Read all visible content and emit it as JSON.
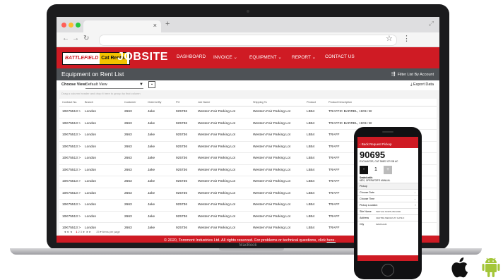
{
  "laptop": {
    "brand": "MacBook"
  },
  "browser": {
    "traffic_lights": [
      "#ff5f57",
      "#febc2e",
      "#28c840"
    ],
    "tab_close": "×",
    "new_tab": "+",
    "expand": "⤢",
    "back": "←",
    "forward": "→",
    "reload": "↻",
    "star": "☆",
    "menu": "⋮"
  },
  "header": {
    "logo_battlefield": "BATTLEFIELD",
    "logo_cat": "Cat Rental",
    "logo_jobsite": "JOBSITE",
    "nav": [
      "DASHBOARD",
      "INVOICE ⌄",
      "EQUIPMENT ⌄",
      "REPORT ⌄",
      "CONTACT US"
    ],
    "brand_color": "#cf1b24"
  },
  "page": {
    "title": "Equipment on Rent List",
    "filter_label": "Filter List By Account",
    "choose_view_label": "Choose View:",
    "view_value": "Default View",
    "export_label": "Export Data",
    "group_hint": "Drag a column header and drop it here to group by that column"
  },
  "table": {
    "headers": [
      "Contract No.",
      "Branch",
      "Customer",
      "Ordered By",
      "PO",
      "Job Name",
      "Shipping To",
      "Product",
      "Product Description"
    ],
    "rows": [
      [
        "10K75513 >",
        "London",
        "2663",
        "Jake",
        "925736",
        "Western Fair Parking Lot",
        "Western Fair Parking Lot",
        "LB54",
        "TRAFFIC BARREL, HIGH W"
      ],
      [
        "10K75513 >",
        "London",
        "2663",
        "Jake",
        "925736",
        "Western Fair Parking Lot",
        "Western Fair Parking Lot",
        "LB54",
        "TRAFFIC BARREL, HIGH W"
      ],
      [
        "10K75513 >",
        "London",
        "2663",
        "Jake",
        "925736",
        "Western Fair Parking Lot",
        "Western Fair Parking Lot",
        "LB54",
        "TRAFF"
      ],
      [
        "10K75513 >",
        "London",
        "2663",
        "Jake",
        "925736",
        "Western Fair Parking Lot",
        "Western Fair Parking Lot",
        "LB54",
        "TRAFF"
      ],
      [
        "10K75513 >",
        "London",
        "2663",
        "Jake",
        "925736",
        "Western Fair Parking Lot",
        "Western Fair Parking Lot",
        "LB54",
        "TRAFF"
      ],
      [
        "10K75513 >",
        "London",
        "2663",
        "Jake",
        "925736",
        "Western Fair Parking Lot",
        "Western Fair Parking Lot",
        "LB54",
        "TRAFF"
      ],
      [
        "10K75513 >",
        "London",
        "2663",
        "Jake",
        "925736",
        "Western Fair Parking Lot",
        "Western Fair Parking Lot",
        "LB54",
        "TRAFF"
      ],
      [
        "10K75513 >",
        "London",
        "2663",
        "Jake",
        "925736",
        "Western Fair Parking Lot",
        "Western Fair Parking Lot",
        "LB54",
        "TRAFF"
      ],
      [
        "10K75513 >",
        "London",
        "2663",
        "Jake",
        "925736",
        "Western Fair Parking Lot",
        "Western Fair Parking Lot",
        "LB54",
        "TRAFF"
      ],
      [
        "10K75513 >",
        "London",
        "2663",
        "Jake",
        "925736",
        "Western Fair Parking Lot",
        "Western Fair Parking Lot",
        "LB54",
        "TRAFF"
      ],
      [
        "10K75513 >",
        "London",
        "2663",
        "Jake",
        "925736",
        "Western Fair Parking Lot",
        "Western Fair Parking Lot",
        "LB54",
        "TRAFF"
      ]
    ]
  },
  "pager": {
    "first": "◄◄",
    "prev": "◄",
    "pages": [
      "1",
      "2",
      "3"
    ],
    "next": "►",
    "last": "►►",
    "page_size": "25 ▾",
    "page_size_label": "items per page"
  },
  "footer": {
    "text": "© 2020, Toromont Industries Ltd. All rights reserved. For problems or technical questions, click",
    "link": "here."
  },
  "phone": {
    "header_title": "Back   Request Pickup",
    "equipment_no": "90695",
    "equipment_desc": "EXCAVATOR, CAT 308E2 CR SB AC",
    "qty_minus": "-",
    "qty_value": "1",
    "qty_plus": "+",
    "sealed_title": "Sealed with:",
    "sealed_item": "6870, OPERATOR'S MANUAL",
    "pickup_label": "Pickup",
    "choose_date": "Choose Date",
    "choose_time": "Choose Time",
    "pickup_location": "Pickup Location",
    "site_name_label": "Site Name",
    "site_name_value": "3WP AIH NORTH BOUND",
    "address_label": "Address",
    "address_value": "CENTRE MEDIAN AT GATE 3",
    "city_label": "City",
    "city_value": "MARKHAM"
  }
}
